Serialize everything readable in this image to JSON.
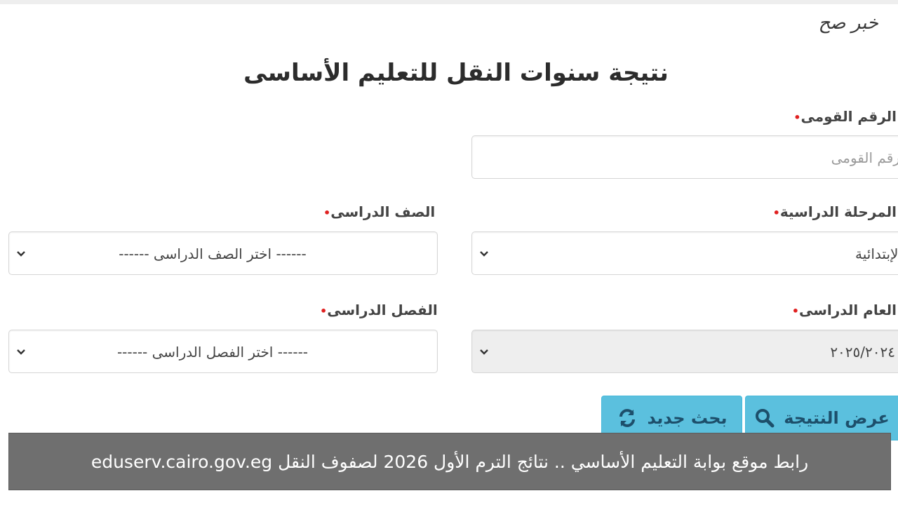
{
  "watermark": "خبر صح",
  "page_title": "نتيجة سنوات النقل للتعليم الأساسى",
  "required_mark": "•",
  "national_id": {
    "label": "الرقم القومى",
    "placeholder": "الرقم القومى"
  },
  "stage": {
    "label": "المرحلة الدراسية",
    "value": "الإبتدائية"
  },
  "grade": {
    "label": "الصف الدراسى",
    "value": "------ اختر الصف الدراسى ------"
  },
  "year": {
    "label": "العام الدراسى",
    "value": "٢٠٢٥/٢٠٢٤"
  },
  "term": {
    "label": "الفصل الدراسى",
    "value": "------ اختر الفصل الدراسى ------"
  },
  "buttons": {
    "show_result": "عرض النتيجة",
    "new_search": "بحث جديد"
  },
  "caption": "رابط موقع بوابة التعليم الأساسي .. نتائج الترم الأول 2026 لصفوف النقل eduserv.cairo.gov.eg",
  "colors": {
    "button_bg": "#5bc0de",
    "caption_bg": "#6f6f6f",
    "required": "#e02020"
  }
}
